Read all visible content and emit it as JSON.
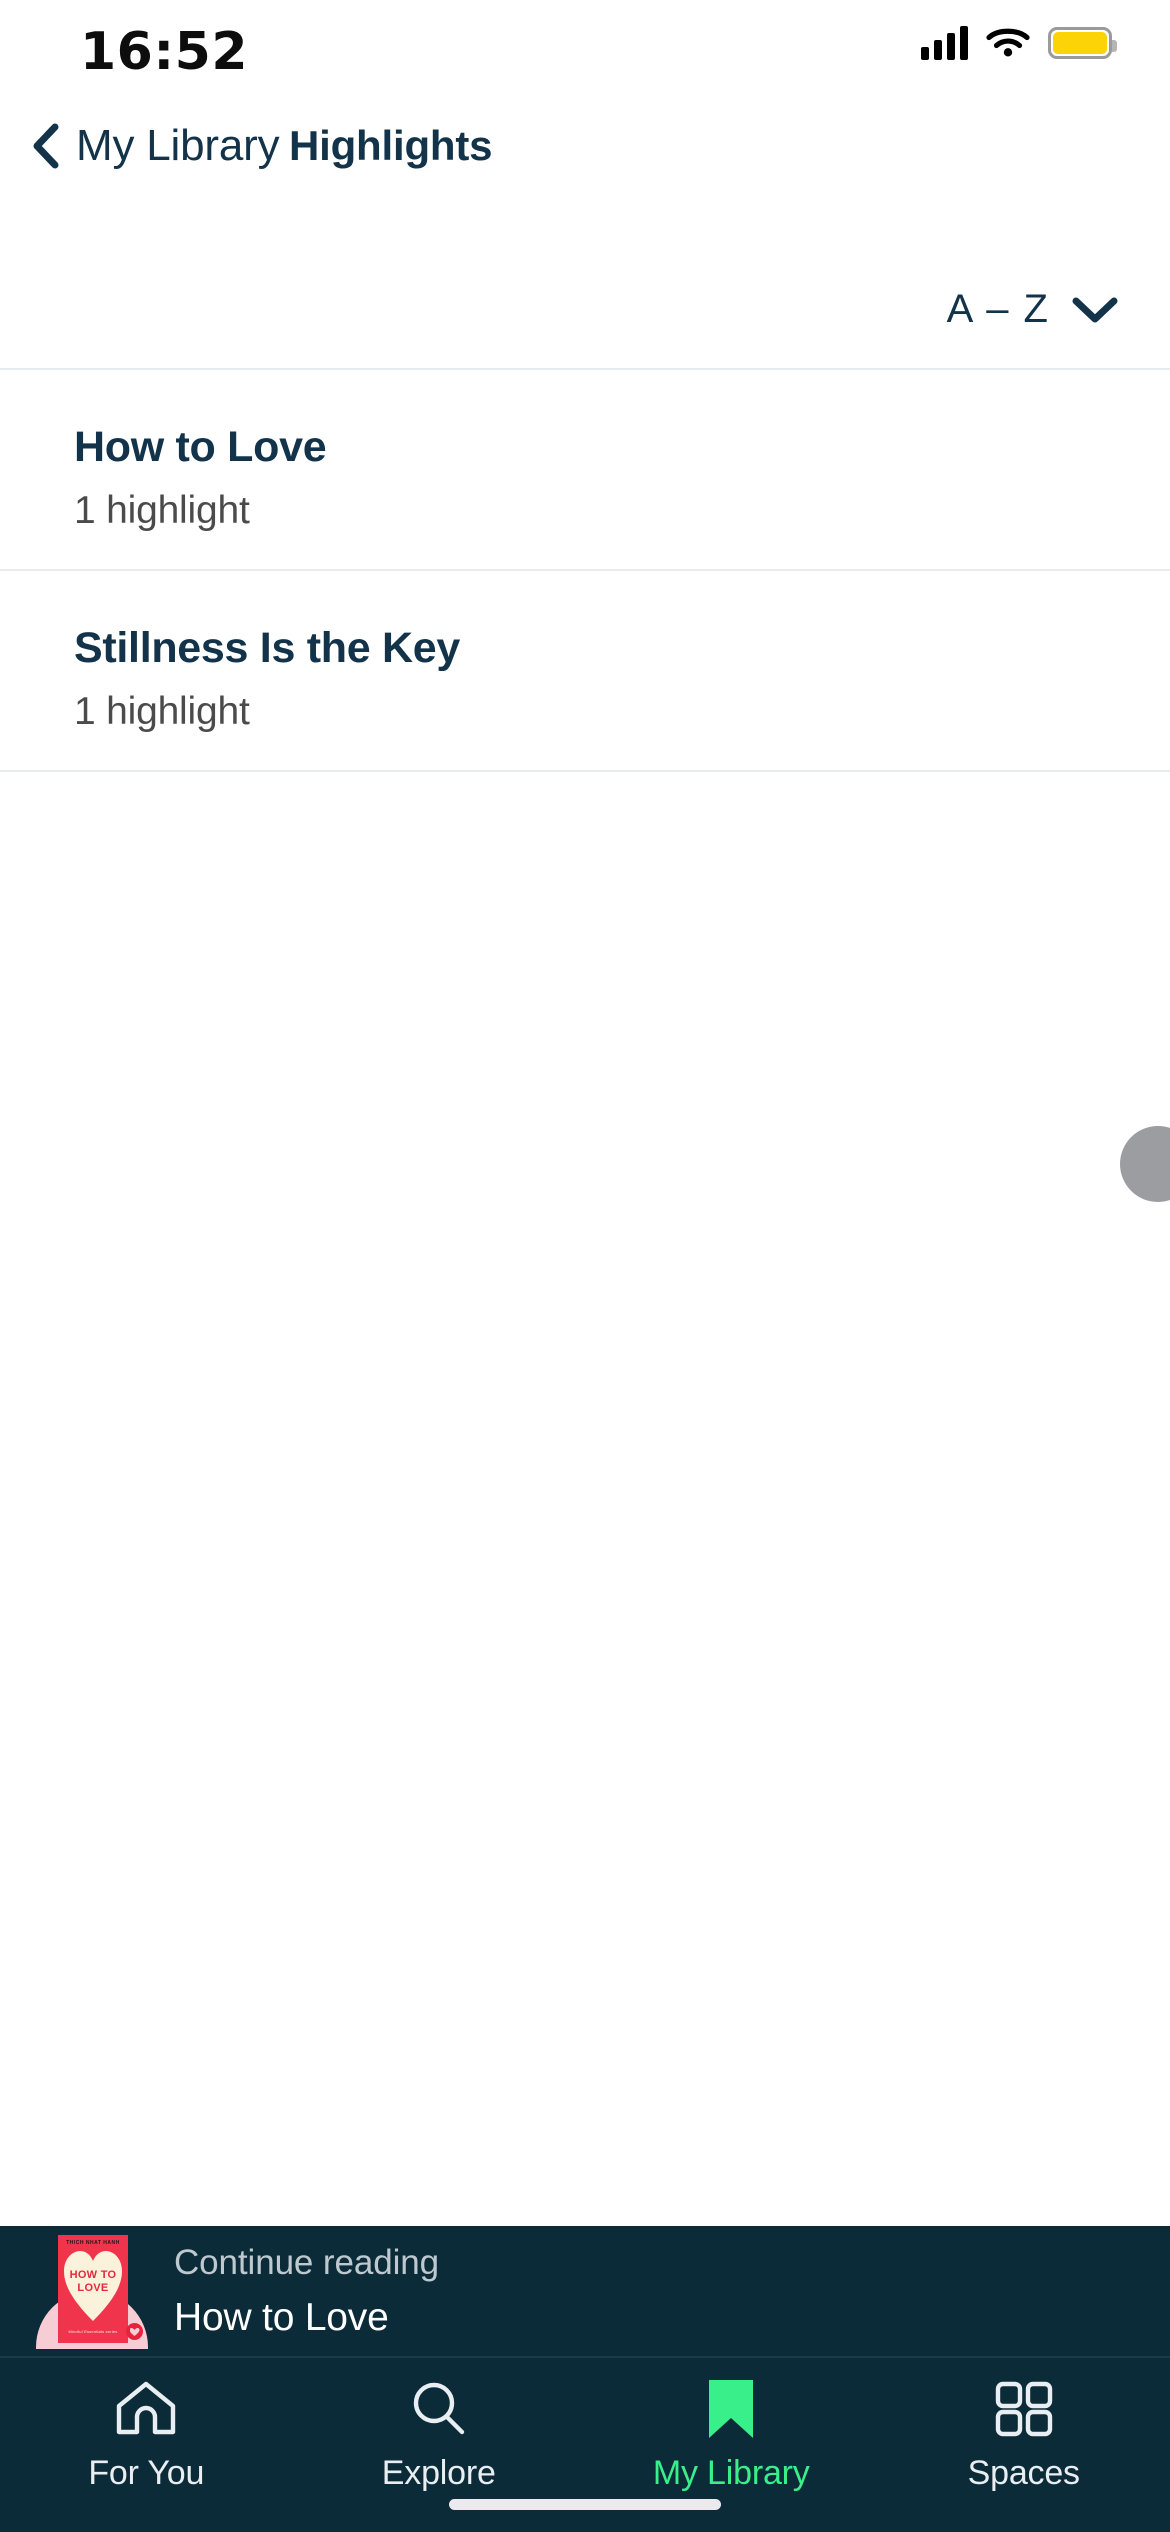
{
  "status_bar": {
    "time": "16:52",
    "signal_icon": "cellular-signal-icon",
    "wifi_icon": "wifi-icon",
    "battery_icon": "battery-icon",
    "battery_color": "#fbd307",
    "battery_level_percent": 100
  },
  "nav": {
    "back_icon": "chevron-left-icon",
    "back_label": "My Library",
    "title": "Highlights"
  },
  "sort": {
    "label": "A – Z",
    "chevron_icon": "chevron-down-icon"
  },
  "list": {
    "items": [
      {
        "title": "How to Love",
        "subtitle": "1 highlight"
      },
      {
        "title": "Stillness Is the Key",
        "subtitle": "1 highlight"
      }
    ]
  },
  "continue_reading": {
    "label": "Continue reading",
    "title": "How to Love",
    "cover": {
      "author": "THICH NHAT HANH",
      "title_line1": "HOW TO",
      "title_line2": "LOVE",
      "subtitle": "Mindful Essentials series",
      "bg_color": "#f0344c",
      "heart_color": "#fbf2db"
    }
  },
  "tabbar": {
    "accent_color": "#38ef89",
    "background_color": "#0c2b38",
    "tabs": [
      {
        "label": "For You",
        "icon": "home-icon",
        "active": false
      },
      {
        "label": "Explore",
        "icon": "search-icon",
        "active": false
      },
      {
        "label": "My Library",
        "icon": "bookmark-icon",
        "active": true
      },
      {
        "label": "Spaces",
        "icon": "grid-icon",
        "active": false
      }
    ]
  },
  "theme": {
    "primary_text": "#123349",
    "secondary_text": "#4b4b4b",
    "divider": "#e9ecee",
    "dark_surface": "#0c2b38"
  }
}
